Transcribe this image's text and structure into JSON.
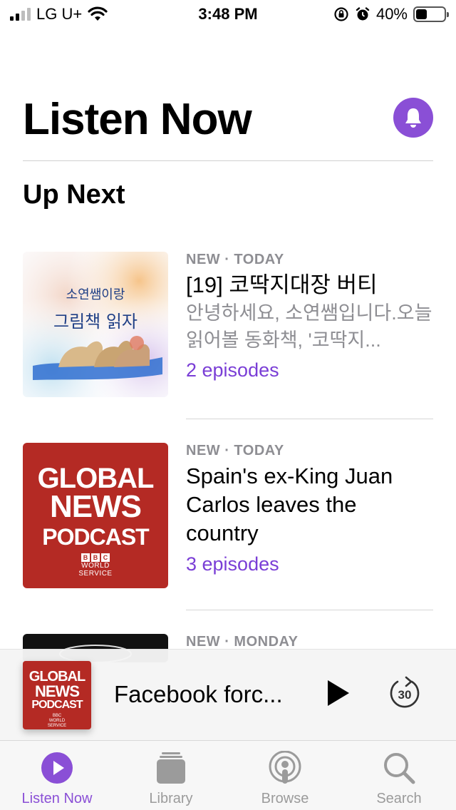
{
  "status_bar": {
    "carrier": "LG U+",
    "time": "3:48 PM",
    "battery": "40%",
    "battery_level": 0.4
  },
  "header": {
    "title": "Listen Now",
    "notification_icon": "bell-icon",
    "accent_color": "#8a4fd6"
  },
  "section": {
    "title": "Up Next"
  },
  "items": [
    {
      "badge": "NEW · TODAY",
      "title": "[19] 코딱지대장 버티",
      "description": "안녕하세요, 소연쌤입니다.오늘 읽어볼 동화책, '코딱지...",
      "episodes": "2 episodes",
      "artwork_text_1": "소연쌤이랑",
      "artwork_text_2": "그림책 읽자"
    },
    {
      "badge": "NEW · TODAY",
      "title": "Spain's ex-King Juan Carlos leaves the country",
      "episodes": "3 episodes",
      "artwork": {
        "line1": "GLOBAL",
        "line2": "NEWS",
        "line3": "PODCAST",
        "brand": "BBC",
        "service_1": "WORLD",
        "service_2": "SERVICE"
      }
    },
    {
      "badge": "NEW · MONDAY"
    }
  ],
  "mini_player": {
    "title": "Facebook forc...",
    "play_icon": "play-icon",
    "skip_icon": "skip-forward-30-icon",
    "skip_seconds": "30"
  },
  "tabs": [
    {
      "label": "Listen Now",
      "icon": "play-circle-icon",
      "active": true
    },
    {
      "label": "Library",
      "icon": "library-icon",
      "active": false
    },
    {
      "label": "Browse",
      "icon": "podcast-icon",
      "active": false
    },
    {
      "label": "Search",
      "icon": "search-icon",
      "active": false
    }
  ]
}
